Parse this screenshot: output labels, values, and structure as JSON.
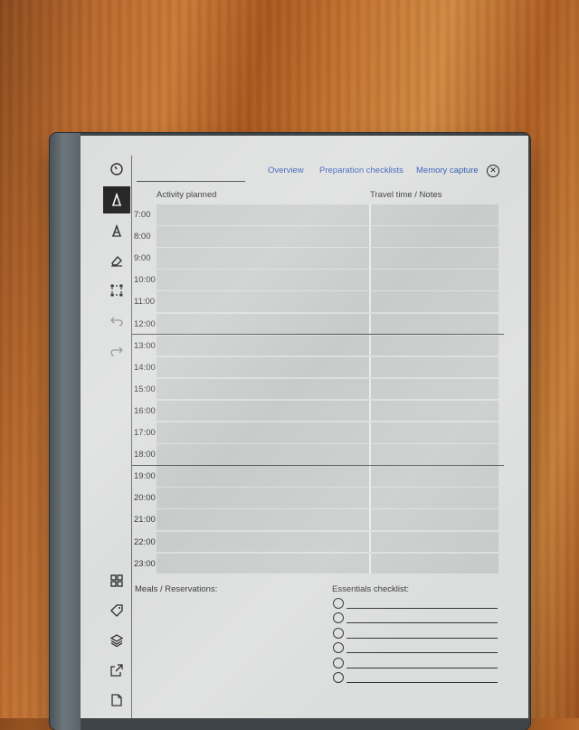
{
  "tabs": [
    "Overview",
    "Preparation checklists",
    "Memory capture"
  ],
  "columns": {
    "activity": "Activity planned",
    "travel": "Travel time / Notes"
  },
  "times": [
    "7:00",
    "8:00",
    "9:00",
    "10:00",
    "11:00",
    "12:00",
    "13:00",
    "14:00",
    "15:00",
    "16:00",
    "17:00",
    "18:00",
    "19:00",
    "20:00",
    "21:00",
    "22:00",
    "23:00"
  ],
  "bottom": {
    "meals": "Meals / Reservations:",
    "essentials": "Essentials checklist:"
  },
  "checklist_count": 6,
  "colors": {
    "link": "#2e55b6",
    "row": "#c9cbcb",
    "screen": "#dcdedd"
  },
  "toolbar_icons": [
    "timer-icon",
    "pen-icon",
    "highlighter-icon",
    "eraser-icon",
    "selection-icon",
    "undo-icon",
    "redo-icon",
    "grid-view-icon",
    "tag-icon",
    "layers-icon",
    "share-icon",
    "page-icon"
  ]
}
